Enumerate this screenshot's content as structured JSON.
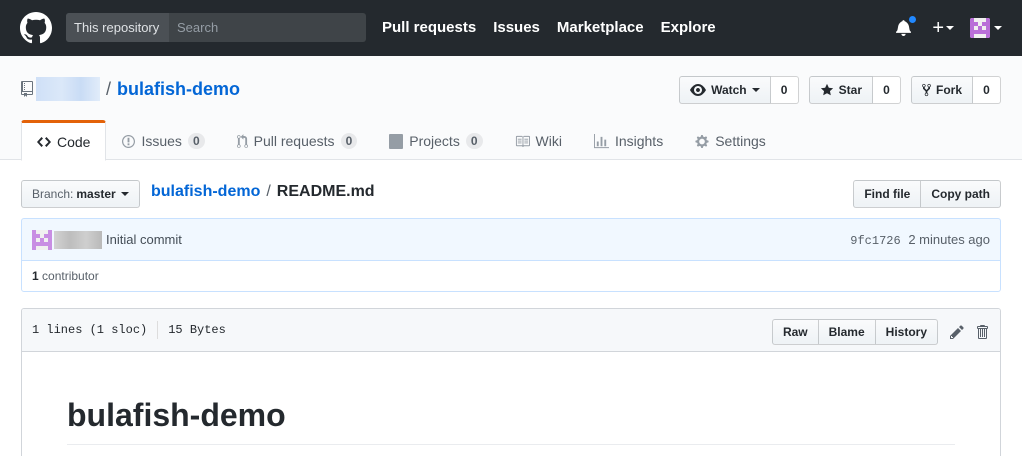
{
  "header": {
    "search_scope": "This repository",
    "search_placeholder": "Search",
    "nav": [
      "Pull requests",
      "Issues",
      "Marketplace",
      "Explore"
    ],
    "plus_label": "+"
  },
  "repo": {
    "name": "bulafish-demo",
    "separator": "/",
    "actions": {
      "watch_label": "Watch",
      "watch_count": "0",
      "star_label": "Star",
      "star_count": "0",
      "fork_label": "Fork",
      "fork_count": "0"
    },
    "tabs": [
      {
        "label": "Code",
        "icon": "code-icon",
        "selected": true
      },
      {
        "label": "Issues",
        "icon": "issue-icon",
        "count": "0"
      },
      {
        "label": "Pull requests",
        "icon": "pull-request-icon",
        "count": "0"
      },
      {
        "label": "Projects",
        "icon": "project-icon",
        "count": "0"
      },
      {
        "label": "Wiki",
        "icon": "book-icon"
      },
      {
        "label": "Insights",
        "icon": "graph-icon"
      },
      {
        "label": "Settings",
        "icon": "gear-icon"
      }
    ]
  },
  "file_nav": {
    "branch_prefix": "Branch:",
    "branch": "master",
    "breadcrumb_repo": "bulafish-demo",
    "breadcrumb_sep": "/",
    "breadcrumb_file": "README.md",
    "find_file": "Find file",
    "copy_path": "Copy path"
  },
  "commit": {
    "message": "Initial commit",
    "sha": "9fc1726",
    "time": "2 minutes ago",
    "contributor_count": "1",
    "contributor_label": "contributor"
  },
  "file": {
    "lines": "1 lines (1 sloc)",
    "size": "15 Bytes",
    "raw": "Raw",
    "blame": "Blame",
    "history": "History",
    "heading": "bulafish-demo"
  },
  "colors": {
    "header_bg": "#24292e",
    "link": "#0366d6",
    "tab_accent": "#e36209",
    "notification": "#2188ff"
  }
}
